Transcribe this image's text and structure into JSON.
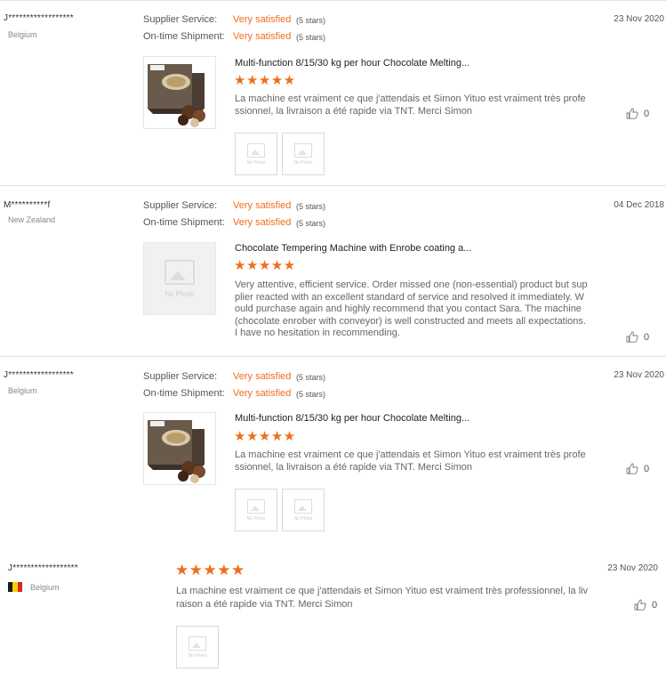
{
  "labels": {
    "supplier_service": "Supplier Service:",
    "ontime_shipment": "On-time Shipment:",
    "very_satisfied": "Very satisfied",
    "five_stars": "(5 stars)",
    "no_photo": "No Photo",
    "stars_glyphs": "★★★★★"
  },
  "colors": {
    "accent": "#f06d1a",
    "flag_black": "#1a1a1a",
    "flag_yellow": "#f5d000",
    "flag_red": "#d8262c"
  },
  "reviews": [
    {
      "name": "J******************",
      "country": "Belgium",
      "date": "23 Nov 2020",
      "product": "Multi-function 8/15/30 kg per hour Chocolate Melting...",
      "rating": 5,
      "text": "La machine est vraiment ce que j'attendais et Simon Yituo est vraiment très professionnel, la livraison a été rapide via TNT. Merci Simon",
      "likes": "0"
    },
    {
      "name": "M**********f",
      "country": "New Zealand",
      "date": "04 Dec 2018",
      "product": "Chocolate Tempering Machine with Enrobe coating a...",
      "rating": 5,
      "text": "Very attentive, efficient service.  Order missed one (non-essential) product but supplier reacted with an excellent standard of service and resolved it immediately. Would purchase again and highly recommend that you contact Sara.  The machine (chocolate enrober with conveyor) is well constructed and meets all expectations. I have no hesitation in recommending.",
      "likes": "0"
    },
    {
      "name": "J******************",
      "country": "Belgium",
      "date": "23 Nov 2020",
      "product": "Multi-function 8/15/30 kg per hour Chocolate Melting...",
      "rating": 5,
      "text": "La machine est vraiment ce que j'attendais et Simon Yituo est vraiment très professionnel, la livraison a été rapide via TNT. Merci Simon",
      "likes": "0"
    },
    {
      "name": "J******************",
      "country": "Belgium",
      "date": "23 Nov 2020",
      "rating": 5,
      "text": "La machine est vraiment ce que j'attendais et Simon Yituo est vraiment très professionnel, la livraison a été rapide via TNT. Merci Simon",
      "likes": "0"
    }
  ]
}
